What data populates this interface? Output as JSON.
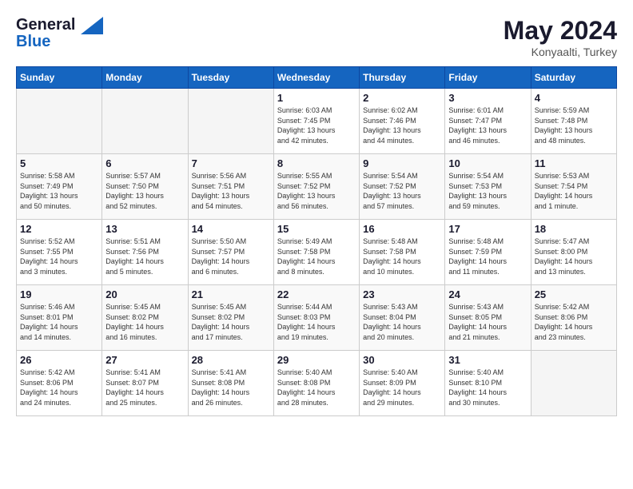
{
  "logo": {
    "line1": "General",
    "line2": "Blue"
  },
  "title": "May 2024",
  "subtitle": "Konyaalti, Turkey",
  "days_header": [
    "Sunday",
    "Monday",
    "Tuesday",
    "Wednesday",
    "Thursday",
    "Friday",
    "Saturday"
  ],
  "weeks": [
    [
      {
        "day": "",
        "info": ""
      },
      {
        "day": "",
        "info": ""
      },
      {
        "day": "",
        "info": ""
      },
      {
        "day": "1",
        "info": "Sunrise: 6:03 AM\nSunset: 7:45 PM\nDaylight: 13 hours\nand 42 minutes."
      },
      {
        "day": "2",
        "info": "Sunrise: 6:02 AM\nSunset: 7:46 PM\nDaylight: 13 hours\nand 44 minutes."
      },
      {
        "day": "3",
        "info": "Sunrise: 6:01 AM\nSunset: 7:47 PM\nDaylight: 13 hours\nand 46 minutes."
      },
      {
        "day": "4",
        "info": "Sunrise: 5:59 AM\nSunset: 7:48 PM\nDaylight: 13 hours\nand 48 minutes."
      }
    ],
    [
      {
        "day": "5",
        "info": "Sunrise: 5:58 AM\nSunset: 7:49 PM\nDaylight: 13 hours\nand 50 minutes."
      },
      {
        "day": "6",
        "info": "Sunrise: 5:57 AM\nSunset: 7:50 PM\nDaylight: 13 hours\nand 52 minutes."
      },
      {
        "day": "7",
        "info": "Sunrise: 5:56 AM\nSunset: 7:51 PM\nDaylight: 13 hours\nand 54 minutes."
      },
      {
        "day": "8",
        "info": "Sunrise: 5:55 AM\nSunset: 7:52 PM\nDaylight: 13 hours\nand 56 minutes."
      },
      {
        "day": "9",
        "info": "Sunrise: 5:54 AM\nSunset: 7:52 PM\nDaylight: 13 hours\nand 57 minutes."
      },
      {
        "day": "10",
        "info": "Sunrise: 5:54 AM\nSunset: 7:53 PM\nDaylight: 13 hours\nand 59 minutes."
      },
      {
        "day": "11",
        "info": "Sunrise: 5:53 AM\nSunset: 7:54 PM\nDaylight: 14 hours\nand 1 minute."
      }
    ],
    [
      {
        "day": "12",
        "info": "Sunrise: 5:52 AM\nSunset: 7:55 PM\nDaylight: 14 hours\nand 3 minutes."
      },
      {
        "day": "13",
        "info": "Sunrise: 5:51 AM\nSunset: 7:56 PM\nDaylight: 14 hours\nand 5 minutes."
      },
      {
        "day": "14",
        "info": "Sunrise: 5:50 AM\nSunset: 7:57 PM\nDaylight: 14 hours\nand 6 minutes."
      },
      {
        "day": "15",
        "info": "Sunrise: 5:49 AM\nSunset: 7:58 PM\nDaylight: 14 hours\nand 8 minutes."
      },
      {
        "day": "16",
        "info": "Sunrise: 5:48 AM\nSunset: 7:58 PM\nDaylight: 14 hours\nand 10 minutes."
      },
      {
        "day": "17",
        "info": "Sunrise: 5:48 AM\nSunset: 7:59 PM\nDaylight: 14 hours\nand 11 minutes."
      },
      {
        "day": "18",
        "info": "Sunrise: 5:47 AM\nSunset: 8:00 PM\nDaylight: 14 hours\nand 13 minutes."
      }
    ],
    [
      {
        "day": "19",
        "info": "Sunrise: 5:46 AM\nSunset: 8:01 PM\nDaylight: 14 hours\nand 14 minutes."
      },
      {
        "day": "20",
        "info": "Sunrise: 5:45 AM\nSunset: 8:02 PM\nDaylight: 14 hours\nand 16 minutes."
      },
      {
        "day": "21",
        "info": "Sunrise: 5:45 AM\nSunset: 8:02 PM\nDaylight: 14 hours\nand 17 minutes."
      },
      {
        "day": "22",
        "info": "Sunrise: 5:44 AM\nSunset: 8:03 PM\nDaylight: 14 hours\nand 19 minutes."
      },
      {
        "day": "23",
        "info": "Sunrise: 5:43 AM\nSunset: 8:04 PM\nDaylight: 14 hours\nand 20 minutes."
      },
      {
        "day": "24",
        "info": "Sunrise: 5:43 AM\nSunset: 8:05 PM\nDaylight: 14 hours\nand 21 minutes."
      },
      {
        "day": "25",
        "info": "Sunrise: 5:42 AM\nSunset: 8:06 PM\nDaylight: 14 hours\nand 23 minutes."
      }
    ],
    [
      {
        "day": "26",
        "info": "Sunrise: 5:42 AM\nSunset: 8:06 PM\nDaylight: 14 hours\nand 24 minutes."
      },
      {
        "day": "27",
        "info": "Sunrise: 5:41 AM\nSunset: 8:07 PM\nDaylight: 14 hours\nand 25 minutes."
      },
      {
        "day": "28",
        "info": "Sunrise: 5:41 AM\nSunset: 8:08 PM\nDaylight: 14 hours\nand 26 minutes."
      },
      {
        "day": "29",
        "info": "Sunrise: 5:40 AM\nSunset: 8:08 PM\nDaylight: 14 hours\nand 28 minutes."
      },
      {
        "day": "30",
        "info": "Sunrise: 5:40 AM\nSunset: 8:09 PM\nDaylight: 14 hours\nand 29 minutes."
      },
      {
        "day": "31",
        "info": "Sunrise: 5:40 AM\nSunset: 8:10 PM\nDaylight: 14 hours\nand 30 minutes."
      },
      {
        "day": "",
        "info": ""
      }
    ]
  ]
}
